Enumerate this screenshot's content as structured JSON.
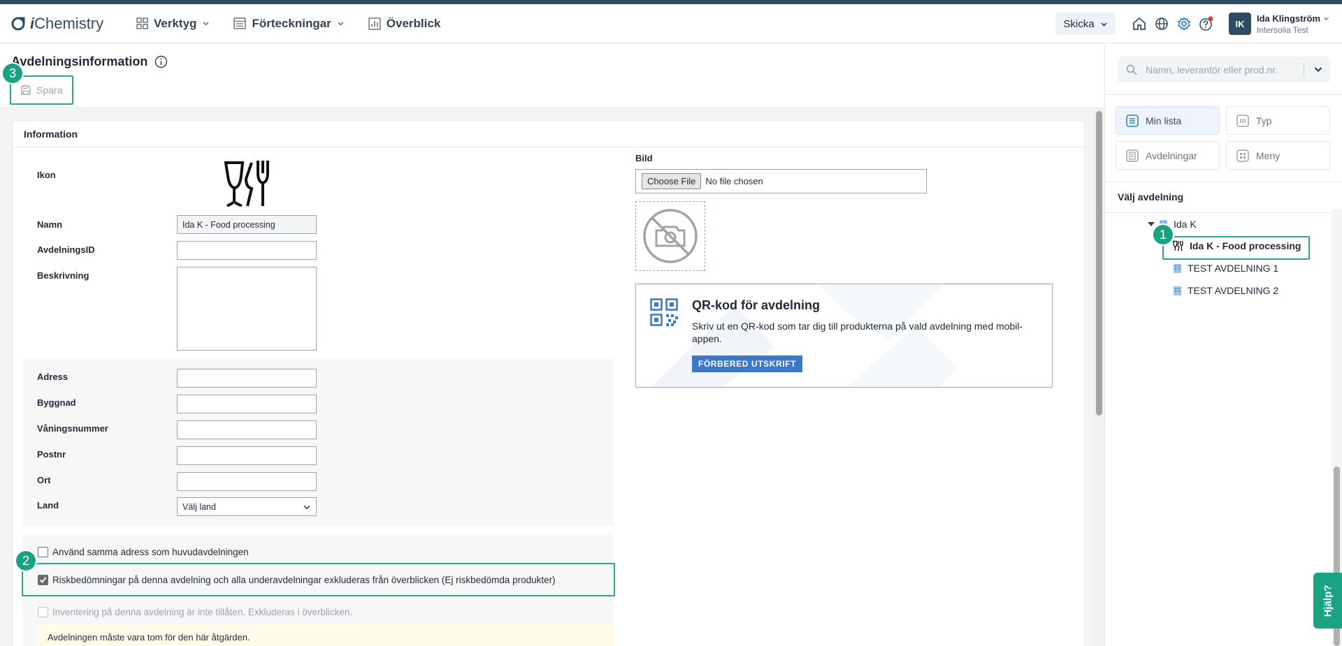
{
  "app": {
    "brand_prefix": "i",
    "brand_name": "Chemistry"
  },
  "nav": {
    "items": [
      {
        "label": "Verktyg"
      },
      {
        "label": "Förteckningar"
      },
      {
        "label": "Överblick"
      }
    ]
  },
  "topbar": {
    "send_label": "Skicka",
    "avatar_initials": "IK",
    "user_name": "Ida Klingström",
    "user_org": "Intersolia Test"
  },
  "page": {
    "title": "Avdelningsinformation",
    "save_label": "Spara",
    "section_title": "Information"
  },
  "form": {
    "icon_label": "Ikon",
    "name_label": "Namn",
    "name_value": "Ida K - Food processing",
    "dept_id_label": "AvdelningsID",
    "dept_id_value": "",
    "description_label": "Beskrivning",
    "description_value": "",
    "address_label": "Adress",
    "address_value": "",
    "building_label": "Byggnad",
    "building_value": "",
    "floor_label": "Våningsnummer",
    "floor_value": "",
    "zip_label": "Postnr",
    "zip_value": "",
    "city_label": "Ort",
    "city_value": "",
    "country_label": "Land",
    "country_value": "Välj land",
    "same_address_label": "Använd samma adress som huvudavdelningen",
    "same_address_checked": false,
    "risk_exclude_label": "Riskbedömningar på denna avdelning och alla underavdelningar exkluderas från överblicken (Ej riskbedömda produkter)",
    "risk_exclude_checked": true,
    "inventory_label": "Inventering på denna avdelning är inte tillåten. Exkluderas i överblicken.",
    "inventory_checked": false,
    "warning_text": "Avdelningen måste vara tom för den här åtgärden."
  },
  "image": {
    "label": "Bild",
    "choose_file_label": "Choose File",
    "no_file_label": "No file chosen"
  },
  "qr": {
    "title": "QR-kod för avdelning",
    "text": "Skriv ut en QR-kod som tar dig till produkterna på vald avdelning med mobil-appen.",
    "button_label": "FÖRBERED UTSKRIFT"
  },
  "sidebar": {
    "search_placeholder": "Namn, leverantör eller prod.nr.",
    "buttons": [
      {
        "label": "Min lista",
        "icon": "list-icon",
        "active": true
      },
      {
        "label": "Typ",
        "icon": "type-icon",
        "active": false
      },
      {
        "label": "Avdelningar",
        "icon": "departments-icon",
        "active": false
      },
      {
        "label": "Meny",
        "icon": "menu-icon",
        "active": false
      }
    ],
    "tree_title": "Välj avdelning",
    "tree": [
      {
        "label": "Ida K",
        "level": 0,
        "icon": "building-icon"
      },
      {
        "label": "Ida K - Food processing",
        "level": 1,
        "icon": "food-icon",
        "selected": true
      },
      {
        "label": "TEST AVDELNING 1",
        "level": 1,
        "icon": "building-icon"
      },
      {
        "label": "TEST AVDELNING 2",
        "level": 1,
        "icon": "building-icon"
      }
    ]
  },
  "annotations": {
    "marker_1": "1",
    "marker_2": "2",
    "marker_3": "3"
  },
  "help": {
    "label": "Hjälp?"
  },
  "colors": {
    "brand": "#2f4d62",
    "highlight": "#2ba88a",
    "marker": "#19a383",
    "qr_button": "#3c78c8"
  }
}
